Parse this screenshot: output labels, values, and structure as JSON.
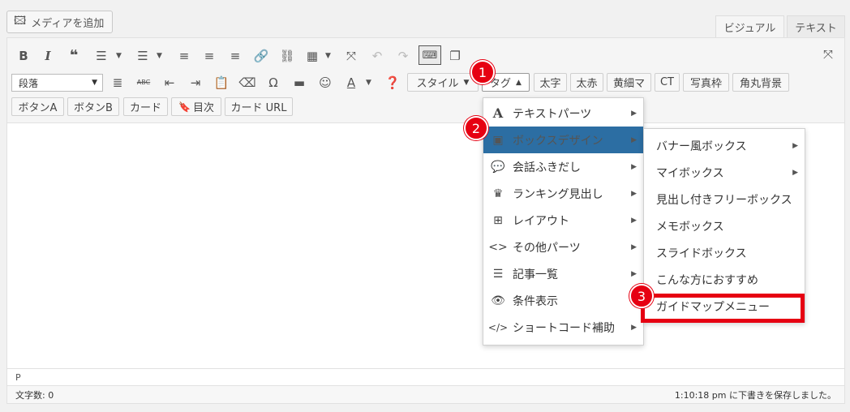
{
  "add_media_label": "メディアを追加",
  "tabs": {
    "visual": "ビジュアル",
    "text": "テキスト"
  },
  "paragraph_select": "段落",
  "toolbar": {
    "style_label": "スタイル",
    "tag_label": "タグ",
    "buttons_row2": [
      "太字",
      "太赤",
      "黄細マ",
      "CT",
      "写真枠",
      "角丸背景"
    ],
    "buttons_row3": [
      "ボタンA",
      "ボタンB",
      "カード",
      "目次",
      "カード URL"
    ]
  },
  "menu1": [
    {
      "label": "テキストパーツ",
      "icon": "A"
    },
    {
      "label": "ボックスデザイン",
      "icon": "box"
    },
    {
      "label": "会話ふきだし",
      "icon": "speech"
    },
    {
      "label": "ランキング見出し",
      "icon": "crown"
    },
    {
      "label": "レイアウト",
      "icon": "grid"
    },
    {
      "label": "その他パーツ",
      "icon": "code-brackets"
    },
    {
      "label": "記事一覧",
      "icon": "list"
    },
    {
      "label": "条件表示",
      "icon": "eye"
    },
    {
      "label": "ショートコード補助",
      "icon": "code"
    }
  ],
  "menu2": [
    "バナー風ボックス",
    "マイボックス",
    "見出し付きフリーボックス",
    "メモボックス",
    "スライドボックス",
    "こんな方におすすめ",
    "ガイドマップメニュー"
  ],
  "markers": [
    "1",
    "2",
    "3"
  ],
  "path": "P",
  "word_count": "文字数: 0",
  "save_status": "1:10:18 pm に下書きを保存しました。",
  "colors": {
    "highlight": "#2c6ea3",
    "marker": "#e60012"
  }
}
